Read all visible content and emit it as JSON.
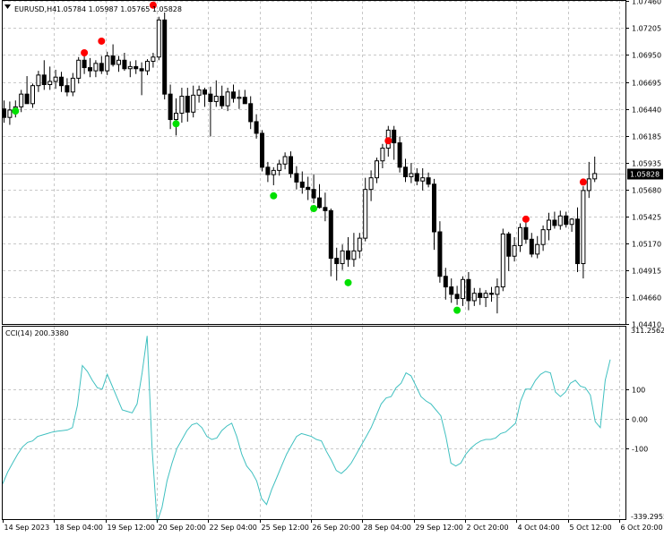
{
  "header": {
    "symbol_label": "EURUSD,H4",
    "ohlc_values": "1.05784 1.05987 1.05765 1.05828"
  },
  "indicator": {
    "label": "CCI(14) 200.3380",
    "axis_max_label": "311.2562",
    "axis_min_label": "-339.2955"
  },
  "colors": {
    "background": "#ffffff",
    "grid": "#c8c8c8",
    "candle_body_bear": "#000000",
    "candle_body_bull": "#ffffff",
    "candle_outline": "#000000",
    "sell_dot": "#ff0000",
    "buy_dot": "#00e000",
    "cci_line": "#40c0c0",
    "price_line": "#c0c0c0",
    "price_tag_bg": "#000000",
    "price_tag_fg": "#ffffff"
  },
  "chart_data": [
    {
      "type": "candlestick",
      "title": "EURUSD,H4",
      "ylim": [
        1.0441,
        1.0746
      ],
      "price_ticks": [
        "1.07460",
        "1.07205",
        "1.06950",
        "1.06695",
        "1.06440",
        "1.06185",
        "1.05935",
        "1.05680",
        "1.05425",
        "1.05170",
        "1.04915",
        "1.04660",
        "1.04410"
      ],
      "current_price": "1.05828",
      "time_labels": [
        "14 Sep 2023",
        "18 Sep 04:00",
        "19 Sep 12:00",
        "20 Sep 20:00",
        "22 Sep 04:00",
        "25 Sep 12:00",
        "26 Sep 20:00",
        "28 Sep 04:00",
        "29 Sep 12:00",
        "2 Oct 20:00",
        "4 Oct 04:00",
        "5 Oct 12:00",
        "6 Oct 20:00"
      ],
      "candles": [
        [
          1.0644,
          1.0652,
          1.0631,
          1.0636
        ],
        [
          1.0636,
          1.0651,
          1.0629,
          1.0643
        ],
        [
          1.0643,
          1.0652,
          1.0636,
          1.0646
        ],
        [
          1.0646,
          1.0662,
          1.0641,
          1.0658
        ],
        [
          1.0658,
          1.0675,
          1.0653,
          1.0649
        ],
        [
          1.0649,
          1.0668,
          1.0645,
          1.0666
        ],
        [
          1.0666,
          1.068,
          1.066,
          1.0676
        ],
        [
          1.0676,
          1.069,
          1.0662,
          1.0667
        ],
        [
          1.0667,
          1.0684,
          1.0662,
          1.067
        ],
        [
          1.067,
          1.0681,
          1.0663,
          1.0674
        ],
        [
          1.0674,
          1.0679,
          1.066,
          1.0666
        ],
        [
          1.0666,
          1.0673,
          1.0656,
          1.066
        ],
        [
          1.066,
          1.0678,
          1.0656,
          1.0673
        ],
        [
          1.0673,
          1.0693,
          1.0668,
          1.069
        ],
        [
          1.069,
          1.0697,
          1.0677,
          1.0683
        ],
        [
          1.0683,
          1.0692,
          1.0674,
          1.068
        ],
        [
          1.068,
          1.069,
          1.0674,
          1.0687
        ],
        [
          1.0687,
          1.0694,
          1.0677,
          1.068
        ],
        [
          1.068,
          1.0698,
          1.0676,
          1.0694
        ],
        [
          1.0694,
          1.0705,
          1.0684,
          1.0686
        ],
        [
          1.0686,
          1.0694,
          1.0679,
          1.069
        ],
        [
          1.069,
          1.0697,
          1.068,
          1.0682
        ],
        [
          1.0682,
          1.0689,
          1.0674,
          1.0684
        ],
        [
          1.0684,
          1.069,
          1.0677,
          1.0682
        ],
        [
          1.0682,
          1.0688,
          1.0657,
          1.068
        ],
        [
          1.068,
          1.0691,
          1.0676,
          1.0689
        ],
        [
          1.0689,
          1.0697,
          1.0683,
          1.0693
        ],
        [
          1.0693,
          1.0731,
          1.069,
          1.0728
        ],
        [
          1.0728,
          1.0735,
          1.0653,
          1.0658
        ],
        [
          1.0658,
          1.0667,
          1.0625,
          1.0634
        ],
        [
          1.0634,
          1.0654,
          1.0619,
          1.064
        ],
        [
          1.064,
          1.0664,
          1.0631,
          1.0656
        ],
        [
          1.0656,
          1.0664,
          1.0632,
          1.0641
        ],
        [
          1.0641,
          1.0666,
          1.0636,
          1.0657
        ],
        [
          1.0657,
          1.0666,
          1.065,
          1.0662
        ],
        [
          1.0662,
          1.0664,
          1.0646,
          1.0658
        ],
        [
          1.0658,
          1.0665,
          1.0618,
          1.0651
        ],
        [
          1.0651,
          1.0671,
          1.0646,
          1.0656
        ],
        [
          1.0656,
          1.0666,
          1.0644,
          1.0647
        ],
        [
          1.0647,
          1.0664,
          1.0642,
          1.066
        ],
        [
          1.066,
          1.0667,
          1.065,
          1.0654
        ],
        [
          1.0654,
          1.0662,
          1.0644,
          1.0655
        ],
        [
          1.0655,
          1.0662,
          1.0649,
          1.0649
        ],
        [
          1.0649,
          1.0656,
          1.0625,
          1.0632
        ],
        [
          1.0632,
          1.0639,
          1.0616,
          1.0621
        ],
        [
          1.0621,
          1.0624,
          1.0585,
          1.0589
        ],
        [
          1.0589,
          1.0594,
          1.0575,
          1.0582
        ],
        [
          1.0582,
          1.0589,
          1.0572,
          1.0586
        ],
        [
          1.0586,
          1.0596,
          1.0581,
          1.0592
        ],
        [
          1.0592,
          1.0603,
          1.0587,
          1.0599
        ],
        [
          1.0599,
          1.0604,
          1.0579,
          1.0583
        ],
        [
          1.0583,
          1.059,
          1.0568,
          1.0575
        ],
        [
          1.0575,
          1.0585,
          1.0564,
          1.057
        ],
        [
          1.057,
          1.058,
          1.0558,
          1.0568
        ],
        [
          1.0568,
          1.0582,
          1.0555,
          1.056
        ],
        [
          1.056,
          1.0573,
          1.055,
          1.0551
        ],
        [
          1.0551,
          1.0565,
          1.0538,
          1.0548
        ],
        [
          1.0548,
          1.055,
          1.0486,
          1.0503
        ],
        [
          1.0503,
          1.0513,
          1.0482,
          1.0498
        ],
        [
          1.0498,
          1.0516,
          1.0492,
          1.051
        ],
        [
          1.051,
          1.0523,
          1.0495,
          1.0502
        ],
        [
          1.0502,
          1.0527,
          1.0495,
          1.051
        ],
        [
          1.051,
          1.0527,
          1.0503,
          1.0522
        ],
        [
          1.0522,
          1.0579,
          1.0519,
          1.0568
        ],
        [
          1.0568,
          1.0586,
          1.0557,
          1.0579
        ],
        [
          1.0579,
          1.0598,
          1.0574,
          1.0595
        ],
        [
          1.0595,
          1.0611,
          1.0588,
          1.0607
        ],
        [
          1.0607,
          1.0628,
          1.0599,
          1.0624
        ],
        [
          1.0624,
          1.0628,
          1.0596,
          1.0612
        ],
        [
          1.0612,
          1.0618,
          1.0584,
          1.0589
        ],
        [
          1.0589,
          1.0597,
          1.0575,
          1.058
        ],
        [
          1.058,
          1.0593,
          1.0574,
          1.0583
        ],
        [
          1.0583,
          1.0588,
          1.0572,
          1.0576
        ],
        [
          1.0576,
          1.0588,
          1.0567,
          1.0579
        ],
        [
          1.0579,
          1.0584,
          1.057,
          1.0573
        ],
        [
          1.0573,
          1.0578,
          1.0511,
          1.0528
        ],
        [
          1.0528,
          1.0538,
          1.048,
          1.0486
        ],
        [
          1.0486,
          1.0494,
          1.0464,
          1.0476
        ],
        [
          1.0476,
          1.0484,
          1.0461,
          1.0469
        ],
        [
          1.0469,
          1.0477,
          1.0459,
          1.0465
        ],
        [
          1.0465,
          1.0486,
          1.0458,
          1.0483
        ],
        [
          1.0483,
          1.049,
          1.0454,
          1.0463
        ],
        [
          1.0463,
          1.0475,
          1.0458,
          1.047
        ],
        [
          1.047,
          1.0475,
          1.0459,
          1.0466
        ],
        [
          1.0466,
          1.0473,
          1.0457,
          1.047
        ],
        [
          1.047,
          1.0476,
          1.0462,
          1.0469
        ],
        [
          1.0469,
          1.0484,
          1.0451,
          1.0476
        ],
        [
          1.0476,
          1.0531,
          1.0472,
          1.0526
        ],
        [
          1.0526,
          1.0528,
          1.0491,
          1.0505
        ],
        [
          1.0505,
          1.0523,
          1.05,
          1.0515
        ],
        [
          1.0515,
          1.0536,
          1.0509,
          1.0532
        ],
        [
          1.0532,
          1.0537,
          1.0517,
          1.0521
        ],
        [
          1.0521,
          1.0527,
          1.0504,
          1.0507
        ],
        [
          1.0507,
          1.0524,
          1.0503,
          1.0516
        ],
        [
          1.0516,
          1.0534,
          1.051,
          1.053
        ],
        [
          1.053,
          1.0546,
          1.052,
          1.0539
        ],
        [
          1.0539,
          1.0547,
          1.0531,
          1.0534
        ],
        [
          1.0534,
          1.0548,
          1.053,
          1.0543
        ],
        [
          1.0543,
          1.0547,
          1.0532,
          1.0535
        ],
        [
          1.0535,
          1.0541,
          1.0528,
          1.054
        ],
        [
          1.054,
          1.0551,
          1.049,
          1.0498
        ],
        [
          1.0498,
          1.0571,
          1.0484,
          1.0567
        ],
        [
          1.0567,
          1.0594,
          1.056,
          1.0578
        ],
        [
          1.0578,
          1.0599,
          1.0575,
          1.0583
        ]
      ],
      "sell_signals": [
        {
          "bar": 14,
          "price": 1.0697
        },
        {
          "bar": 17,
          "price": 1.0708
        },
        {
          "bar": 26,
          "price": 1.0742
        },
        {
          "bar": 67,
          "price": 1.0614
        },
        {
          "bar": 91,
          "price": 1.054
        },
        {
          "bar": 101,
          "price": 1.0575
        }
      ],
      "buy_signals": [
        {
          "bar": 2,
          "price": 1.0642
        },
        {
          "bar": 30,
          "price": 1.063
        },
        {
          "bar": 47,
          "price": 1.0562
        },
        {
          "bar": 54,
          "price": 1.055
        },
        {
          "bar": 60,
          "price": 1.048
        },
        {
          "bar": 79,
          "price": 1.0454
        }
      ]
    },
    {
      "type": "line",
      "title": "CCI(14) 200.3380",
      "ylim": [
        -339.2955,
        311.2562
      ],
      "yticks": [
        100,
        0,
        -100
      ],
      "ytick_labels": [
        "100",
        "0.00",
        "-100"
      ],
      "series": [
        {
          "values": [
            -220,
            -180,
            -150,
            -120,
            -95,
            -80,
            -75,
            -60,
            -55,
            -50,
            -45,
            -42,
            -40,
            -38,
            -30,
            45,
            180,
            160,
            130,
            105,
            100,
            150,
            110,
            70,
            30,
            25,
            20,
            50,
            155,
            280,
            -100,
            -350,
            -300,
            -210,
            -150,
            -100,
            -70,
            -40,
            -20,
            -15,
            -30,
            -60,
            -70,
            -65,
            -40,
            -25,
            -15,
            -60,
            -120,
            -160,
            -180,
            -210,
            -270,
            -290,
            -240,
            -200,
            -160,
            -120,
            -90,
            -60,
            -50,
            -55,
            -60,
            -70,
            -75,
            -110,
            -140,
            -175,
            -185,
            -170,
            -150,
            -120,
            -90,
            -60,
            -30,
            10,
            50,
            70,
            75,
            105,
            120,
            155,
            145,
            110,
            75,
            60,
            50,
            30,
            10,
            -60,
            -150,
            -160,
            -150,
            -120,
            -100,
            -85,
            -75,
            -70,
            -70,
            -65,
            -50,
            -45,
            -30,
            -15,
            60,
            100,
            100,
            130,
            150,
            160,
            155,
            90,
            75,
            90,
            120,
            130,
            110,
            105,
            80,
            -10,
            -30,
            130,
            200
          ]
        }
      ]
    }
  ]
}
